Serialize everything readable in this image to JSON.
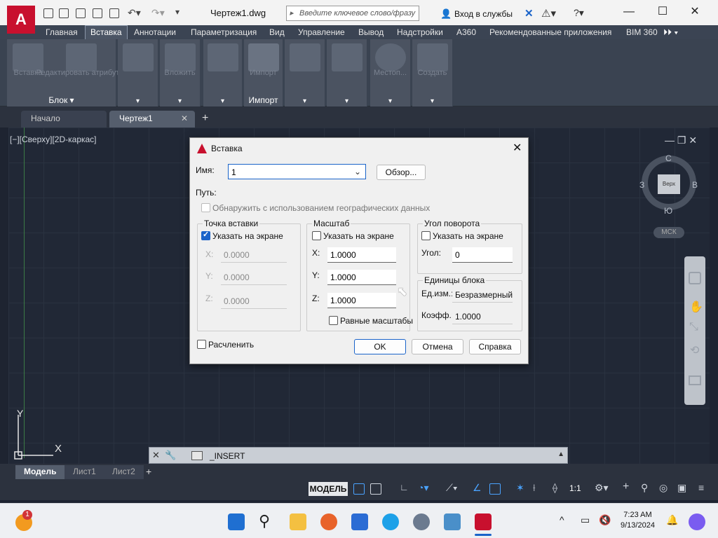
{
  "app": {
    "logo_letter": "A",
    "doc_title": "Чертеж1.dwg",
    "search_placeholder": "Введите ключевое слово/фразу",
    "login": "Вход в службы",
    "window_controls": [
      "—",
      "☐",
      "✕"
    ]
  },
  "menu": {
    "tabs": [
      "Главная",
      "Вставка",
      "Аннотации",
      "Параметризация",
      "Вид",
      "Управление",
      "Вывод",
      "Надстройки",
      "A360",
      "Рекомендованные приложения",
      "BIM 360"
    ],
    "active": "Вставка"
  },
  "ribbon": {
    "block_panel_label": "Блок",
    "import_panel_label": "Импорт",
    "insert_btn": "Вставка",
    "edit_attr_btn": "Редактировать атрибуты",
    "import_btn": "Импорт",
    "attach_btn": "Вложить",
    "location_btn": "Местоп...",
    "create_btn": "Создать"
  },
  "file_tabs": {
    "start": "Начало",
    "drawing": "Чертеж1",
    "close": "✕",
    "add": "+"
  },
  "viewport": {
    "label": "[−][Сверху][2D-каркас]",
    "controls": "—  ❐  ✕",
    "compass_n": "С",
    "compass_s": "Ю",
    "compass_w": "З",
    "compass_e": "В",
    "cube_top": "Верх",
    "ucs_badge": "МСК",
    "ucs_y": "Y",
    "ucs_x": "X"
  },
  "dialog": {
    "title": "Вставка",
    "name_label": "Имя:",
    "name_value": "1",
    "browse": "Обзор...",
    "path_label": "Путь:",
    "geo_label": "Обнаружить с использованием географических данных",
    "insertion": {
      "title": "Точка вставки",
      "on_screen": "Указать на экране",
      "x_label": "X:",
      "x": "0.0000",
      "y_label": "Y:",
      "y": "0.0000",
      "z_label": "Z:",
      "z": "0.0000"
    },
    "scale": {
      "title": "Масштаб",
      "on_screen": "Указать на экране",
      "x_label": "X:",
      "x": "1.0000",
      "y_label": "Y:",
      "y": "1.0000",
      "z_label": "Z:",
      "z": "1.0000",
      "uniform": "Равные масштабы"
    },
    "rotation": {
      "title": "Угол поворота",
      "on_screen": "Указать на экране",
      "angle_label": "Угол:",
      "angle": "0"
    },
    "units": {
      "title": "Единицы блока",
      "unit_label": "Ед.изм.:",
      "unit_value": "Безразмерный",
      "factor_label": "Коэфф.:",
      "factor_value": "1.0000"
    },
    "explode": "Расчленить",
    "ok": "OK",
    "cancel": "Отмена",
    "help": "Справка"
  },
  "command_line": "_INSERT",
  "layout_tabs": [
    "Модель",
    "Лист1",
    "Лист2"
  ],
  "status": {
    "model": "МОДЕЛЬ",
    "scale": "1:1"
  },
  "taskbar": {
    "notification_count": "1",
    "time": "7:23 AM",
    "date": "9/13/2024"
  },
  "colors": {
    "autocad_red": "#c8102e",
    "accent_blue": "#1a63c9",
    "canvas": "#212836"
  }
}
